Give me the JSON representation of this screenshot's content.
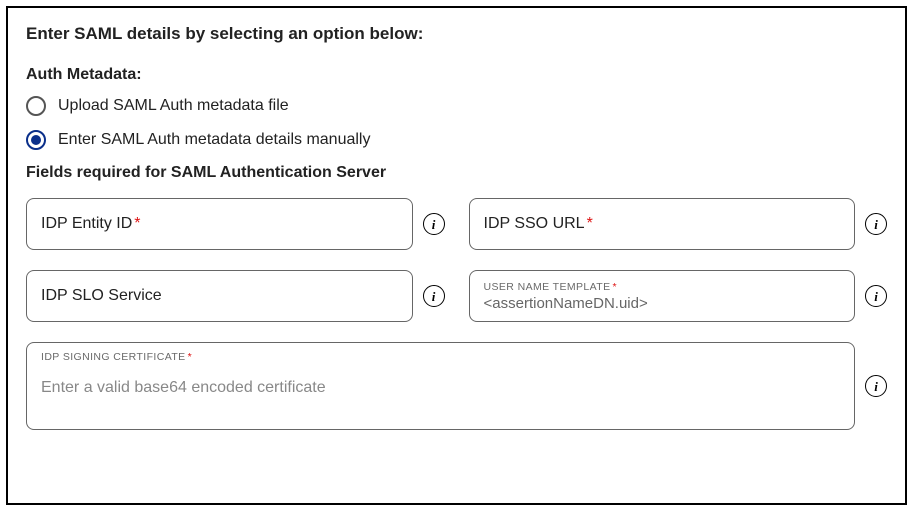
{
  "heading": "Enter SAML details by selecting an option below:",
  "authMetadata": {
    "label": "Auth Metadata:",
    "options": {
      "upload": "Upload SAML Auth metadata file",
      "manual": "Enter SAML Auth metadata details manually"
    },
    "selected": "manual"
  },
  "fieldsHeading": "Fields required for SAML Authentication Server",
  "fields": {
    "idpEntityId": {
      "label": "IDP Entity ID",
      "required": true,
      "value": ""
    },
    "idpSsoUrl": {
      "label": "IDP SSO URL",
      "required": true,
      "value": ""
    },
    "idpSlo": {
      "label": "IDP SLO Service",
      "required": false,
      "value": ""
    },
    "userNameTemplate": {
      "floatLabel": "USER NAME TEMPLATE",
      "required": true,
      "value": "<assertionNameDN.uid>"
    },
    "idpSigningCert": {
      "floatLabel": "IDP SIGNING CERTIFICATE",
      "required": true,
      "placeholder": "Enter a valid base64 encoded certificate",
      "value": ""
    }
  },
  "glyphs": {
    "requiredMark": "*"
  }
}
